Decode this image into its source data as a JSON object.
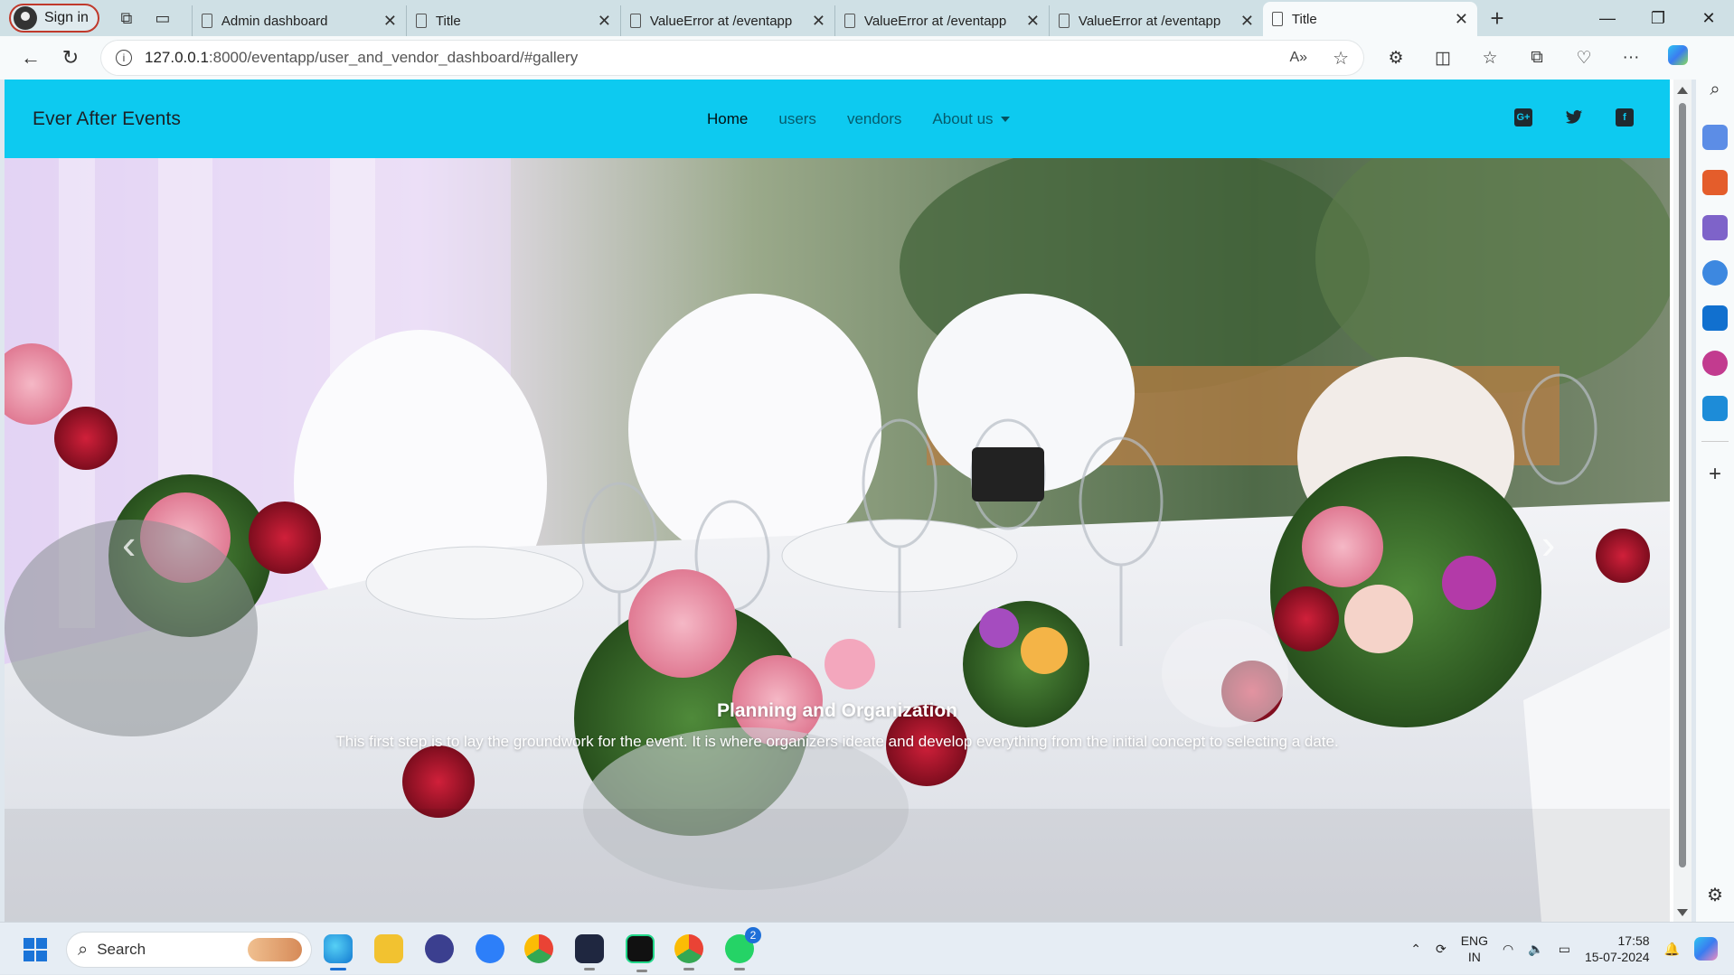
{
  "browser": {
    "signin_label": "Sign in",
    "tabs": [
      {
        "title": "Admin dashboard",
        "active": false
      },
      {
        "title": "Title",
        "active": false
      },
      {
        "title": "ValueError at /eventapp",
        "active": false
      },
      {
        "title": "ValueError at /eventapp",
        "active": false
      },
      {
        "title": "ValueError at /eventapp",
        "active": false
      },
      {
        "title": "Title",
        "active": true
      }
    ],
    "url_host": "127.0.0.1",
    "url_path": ":8000/eventapp/user_and_vendor_dashboard/#gallery"
  },
  "site": {
    "brand": "Ever After Events",
    "nav": {
      "home": "Home",
      "users": "users",
      "vendors": "vendors",
      "about": "About us"
    },
    "social_icons": [
      "google-plus-icon",
      "twitter-icon",
      "facebook-icon"
    ],
    "accent_color": "#0dcaf0",
    "carousel": {
      "prev": "‹",
      "next": "›",
      "caption_title": "Planning and Organization",
      "caption_text": "This first step is to lay the groundwork for the event. It is where organizers ideate and develop everything from the initial concept to selecting a date."
    }
  },
  "taskbar": {
    "search_label": "Search",
    "whatsapp_badge": "2",
    "lang_top": "ENG",
    "lang_bottom": "IN",
    "time": "17:58",
    "date": "15-07-2024"
  }
}
